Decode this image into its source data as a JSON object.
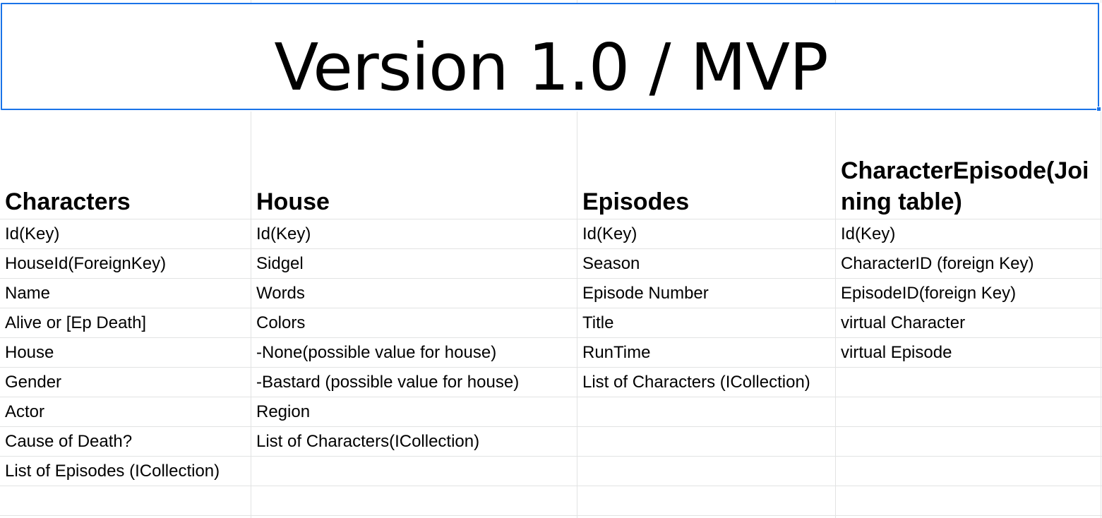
{
  "title": "Version 1.0 / MVP",
  "headers": [
    "Characters",
    "House",
    "Episodes",
    "CharacterEpisode(Joining table)"
  ],
  "rows": [
    [
      "Id(Key)",
      "Id(Key)",
      "Id(Key)",
      "Id(Key)"
    ],
    [
      "HouseId(ForeignKey)",
      "Sidgel",
      "Season",
      "CharacterID (foreign Key)"
    ],
    [
      "Name",
      "Words",
      "Episode Number",
      "EpisodeID(foreign Key)"
    ],
    [
      "Alive or [Ep Death]",
      "Colors",
      "Title",
      "virtual Character"
    ],
    [
      "House",
      "-None(possible value for house)",
      "RunTime",
      "virtual Episode"
    ],
    [
      "Gender",
      "-Bastard (possible value for house)",
      "List of Characters (ICollection)",
      ""
    ],
    [
      "Actor",
      "Region",
      "",
      ""
    ],
    [
      "Cause of Death?",
      "List of Characters(ICollection)",
      "",
      ""
    ],
    [
      "List of Episodes (ICollection)",
      "",
      "",
      ""
    ],
    [
      "",
      "",
      "",
      ""
    ]
  ]
}
